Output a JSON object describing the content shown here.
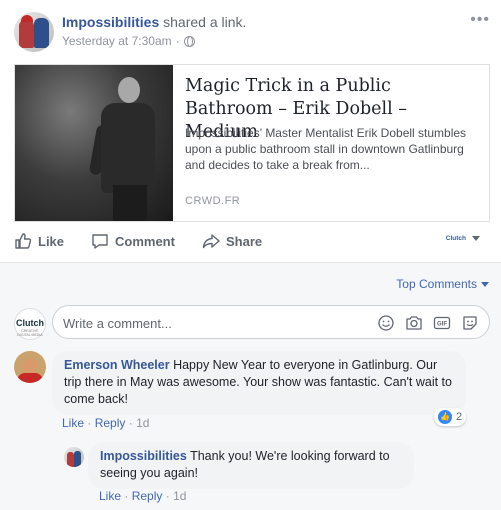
{
  "post": {
    "page_name": "Impossibilities",
    "action": "shared a link.",
    "timestamp": "Yesterday at 7:30am",
    "separator": "·",
    "more": "•••"
  },
  "link": {
    "title": "Magic Trick in a Public Bathroom – Erik Dobell – Medium",
    "description": "Impossibilities' Master Mentalist Erik Dobell stumbles upon a public bathroom stall in downtown Gatlinburg and decides to take a break from...",
    "domain": "CRWD.FR"
  },
  "actions": {
    "like": "Like",
    "comment": "Comment",
    "share": "Share",
    "page_selector": "Clutch"
  },
  "comments_section": {
    "sort_label": "Top Comments",
    "input_placeholder": "Write a comment...",
    "composer_logo": "Clutch",
    "composer_logo_sub": "CREATIVE DIGITAL MEDIA",
    "input_icons": [
      "emoji-icon",
      "camera-icon",
      "gif-icon",
      "sticker-icon"
    ]
  },
  "comments": [
    {
      "author": "Emerson Wheeler",
      "text": "Happy New Year to everyone in Gatlinburg. Our trip there in May was awesome. Your show was fantastic. Can't wait to come back!",
      "like": "Like",
      "reply": "Reply",
      "sep": "·",
      "age": "1d",
      "reaction_count": "2"
    },
    {
      "author": "Impossibilities",
      "text": "Thank you! We're looking forward to seeing you again!",
      "like": "Like",
      "reply": "Reply",
      "sep": "·",
      "age": "1d"
    }
  ],
  "colors": {
    "link_blue": "#365899",
    "action_blue": "#4267b2",
    "meta_gray": "#90949c",
    "background": "#f6f7f9"
  }
}
